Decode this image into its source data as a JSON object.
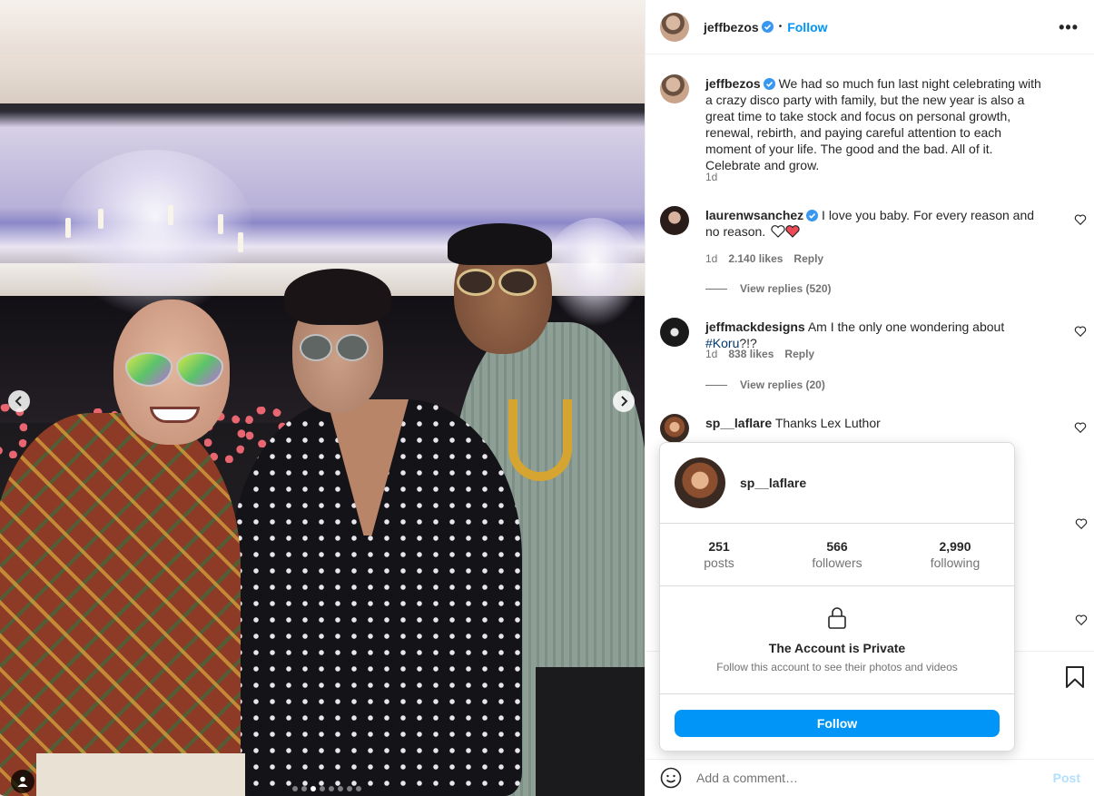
{
  "post": {
    "author": "jeffbezos",
    "follow_label": "Follow",
    "separator": "•",
    "more_label": "•••",
    "caption": "We had so much fun last night celebrating with a crazy disco party with family, but the new year is also a great time to take stock and focus on personal growth, renewal, rebirth, and paying careful attention to each moment of your life. The good and the bad. All of it. Celebrate and grow.",
    "caption_time": "1d",
    "carousel": {
      "total": 8,
      "active": 3
    }
  },
  "comments": [
    {
      "username": "laurenwsanchez",
      "verified": true,
      "text": "I love you baby. For every reason and no reason.",
      "time": "1d",
      "likes": "2.140 likes",
      "reply": "Reply",
      "view_replies": "View replies (520)"
    },
    {
      "username": "jeffmackdesigns",
      "text_before": "Am I the only one wondering about ",
      "hashtag": "#Koru",
      "text_after": "?!?",
      "time": "1d",
      "likes": "838 likes",
      "reply": "Reply",
      "view_replies": "View replies (20)"
    },
    {
      "username": "sp__laflare",
      "text": "Thanks Lex Luthor"
    }
  ],
  "hover_card": {
    "username": "sp__laflare",
    "stats": [
      {
        "value": "251",
        "label": "posts"
      },
      {
        "value": "566",
        "label": "followers"
      },
      {
        "value": "2,990",
        "label": "following"
      }
    ],
    "private_title": "The Account is Private",
    "private_subtitle": "Follow this account to see their photos and videos",
    "follow_label": "Follow"
  },
  "comment_box": {
    "placeholder": "Add a comment…",
    "post_label": "Post"
  },
  "colors": {
    "accent": "#0095f6",
    "verified": "#3897f0",
    "heart_red": "#ed4956"
  }
}
